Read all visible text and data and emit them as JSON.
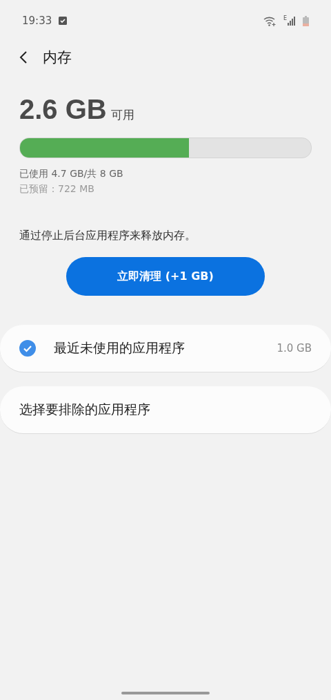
{
  "status_bar": {
    "time": "19:33",
    "network_type": "E"
  },
  "header": {
    "title": "内存"
  },
  "summary": {
    "amount": "2.6 GB",
    "unit_label": "可用",
    "level": 0.58,
    "used": "已使用 4.7 GB/共 8 GB",
    "reserved": "已预留：722 MB"
  },
  "description": "通过停止后台应用程序来释放内存。",
  "clean_button": "立即清理 (+1 GB)",
  "options": [
    {
      "kind": "check",
      "label": "最近未使用的应用程序",
      "value": "1.0 GB",
      "checked": true
    },
    {
      "kind": "link",
      "label": "选择要排除的应用程序"
    }
  ]
}
